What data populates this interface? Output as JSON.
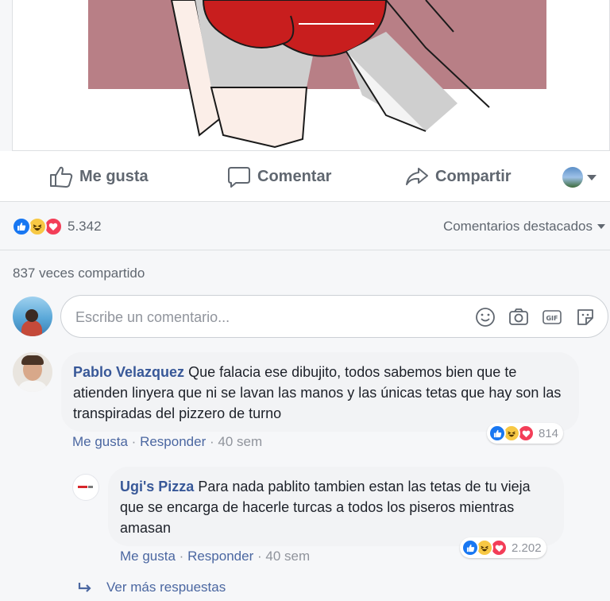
{
  "actions": {
    "like_label": "Me gusta",
    "comment_label": "Comentar",
    "share_label": "Compartir"
  },
  "summary": {
    "reaction_count": "5.342",
    "sort_label": "Comentarios destacados",
    "shares_text": "837 veces compartido"
  },
  "composer": {
    "placeholder": "Escribe un comentario..."
  },
  "comments": [
    {
      "author": "Pablo Velazquez",
      "text": "Que falacia ese dibujito, todos sabemos bien que te atienden linyera que ni se lavan las manos y las únicas tetas que hay son las transpiradas del pizzero de turno",
      "reactions": "814",
      "like": "Me gusta",
      "reply": "Responder",
      "time": "40 sem",
      "replies": [
        {
          "author": "Ugi's Pizza",
          "text": "Para nada pablito tambien estan las tetas de tu vieja que se encarga de hacerle turcas a todos los piseros mientras amasan",
          "reactions": "2.202",
          "like": "Me gusta",
          "reply": "Responder",
          "time": "40 sem"
        }
      ]
    }
  ],
  "more_replies_label": "Ver más respuestas",
  "colors": {
    "link": "#385898",
    "like_blue": "#1877f2",
    "haha_yellow": "#f7c844",
    "love_red": "#f33e58",
    "image_bg": "#b87f86"
  },
  "icons": [
    "thumbs-up-icon",
    "comment-bubble-icon",
    "share-arrow-icon",
    "globe-icon",
    "emoji-icon",
    "camera-icon",
    "gif-icon",
    "sticker-icon",
    "reply-arrow-icon"
  ]
}
